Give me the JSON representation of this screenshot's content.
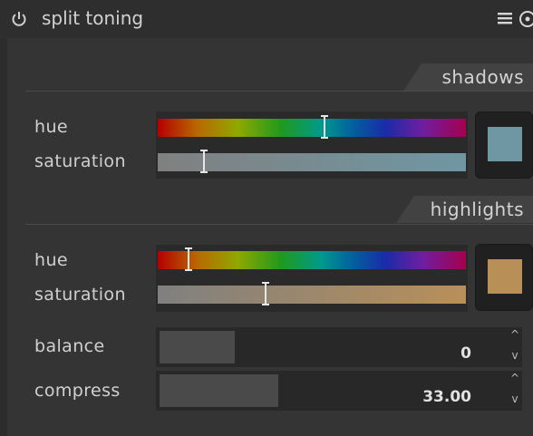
{
  "header": {
    "title": "split toning",
    "power_icon": "power-icon",
    "menu_icon": "hamburger-menu-icon",
    "reset_icon": "reset-icon"
  },
  "shadows": {
    "section_label": "shadows",
    "hue_label": "hue",
    "hue_value": 0.54,
    "saturation_label": "saturation",
    "saturation_value": 0.15,
    "color": "#6f97a3"
  },
  "highlights": {
    "section_label": "highlights",
    "hue_label": "hue",
    "hue_value": 0.1,
    "saturation_label": "saturation",
    "saturation_value": 0.35,
    "color": "#b98f58"
  },
  "balance": {
    "label": "balance",
    "value": "0",
    "fill_fraction": 0.21,
    "up_glyph": "^",
    "down_glyph": "v"
  },
  "compress": {
    "label": "compress",
    "value": "33.00",
    "fill_fraction": 0.33,
    "up_glyph": "^",
    "down_glyph": "v"
  }
}
